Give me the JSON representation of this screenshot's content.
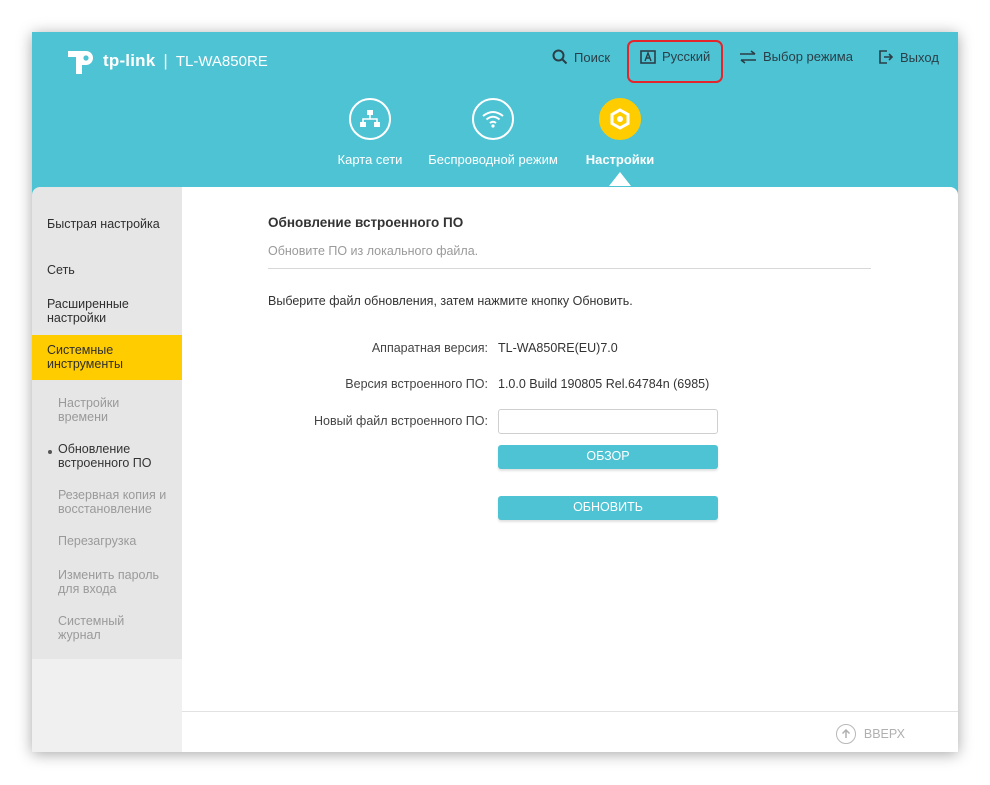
{
  "header": {
    "brand": "tp-link",
    "separator": "|",
    "model": "TL-WA850RE",
    "nav": {
      "search": "Поиск",
      "language": "Русский",
      "mode": "Выбор режима",
      "logout": "Выход"
    },
    "tabs": [
      {
        "label": "Карта сети",
        "icon": "network-map-icon"
      },
      {
        "label": "Беспроводной режим",
        "icon": "wifi-icon"
      },
      {
        "label": "Настройки",
        "icon": "settings-gear-icon",
        "active": true
      }
    ]
  },
  "sidebar": {
    "items": [
      {
        "label": "Быстрая настройка"
      },
      {
        "label": "Сеть"
      },
      {
        "label": "Расширенные настройки"
      },
      {
        "label": "Системные инструменты",
        "active": true
      }
    ],
    "sub_items": [
      {
        "label": "Настройки времени"
      },
      {
        "label": "Обновление встроенного ПО",
        "current": true
      },
      {
        "label": "Резервная копия и восстановление"
      },
      {
        "label": "Перезагрузка"
      },
      {
        "label": "Изменить пароль для входа"
      },
      {
        "label": "Системный журнал"
      }
    ]
  },
  "main": {
    "title": "Обновление встроенного ПО",
    "subtitle": "Обновите ПО из локального файла.",
    "description": "Выберите файл обновления, затем нажмите кнопку Обновить.",
    "hardware_label": "Аппаратная версия:",
    "hardware_value": "TL-WA850RE(EU)7.0",
    "firmware_label": "Версия встроенного ПО:",
    "firmware_value": "1.0.0 Build 190805 Rel.64784n (6985)",
    "newfile_label": "Новый файл встроенного ПО:",
    "newfile_value": "",
    "browse_label": "ОБЗОР",
    "update_label": "ОБНОВИТЬ"
  },
  "footer": {
    "up_label": "ВВЕРХ"
  },
  "colors": {
    "header_bg": "#4ec3d3",
    "accent_yellow": "#ffcc00",
    "highlight_red": "#e5252c",
    "button_bg": "#4ec3d3"
  }
}
